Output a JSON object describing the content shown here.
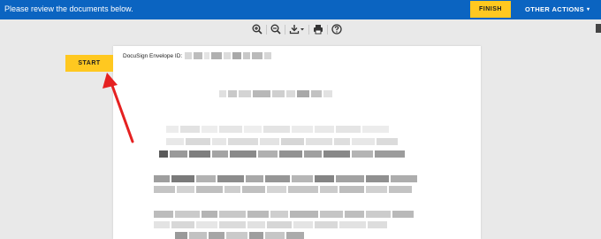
{
  "topbar": {
    "message": "Please review the documents below.",
    "finish_label": "FINISH",
    "other_actions_label": "OTHER ACTIONS",
    "other_actions_caret": "▾"
  },
  "toolbar": {
    "icons": [
      "zoom-in-icon",
      "zoom-out-icon",
      "download-icon",
      "print-icon",
      "help-icon"
    ]
  },
  "start_label": "START",
  "document": {
    "envelope_label": "DocuSign Envelope ID:"
  },
  "colors": {
    "brand_blue": "#0b64c1",
    "accent_yellow": "#ffc820",
    "arrow_red": "#e52121"
  }
}
